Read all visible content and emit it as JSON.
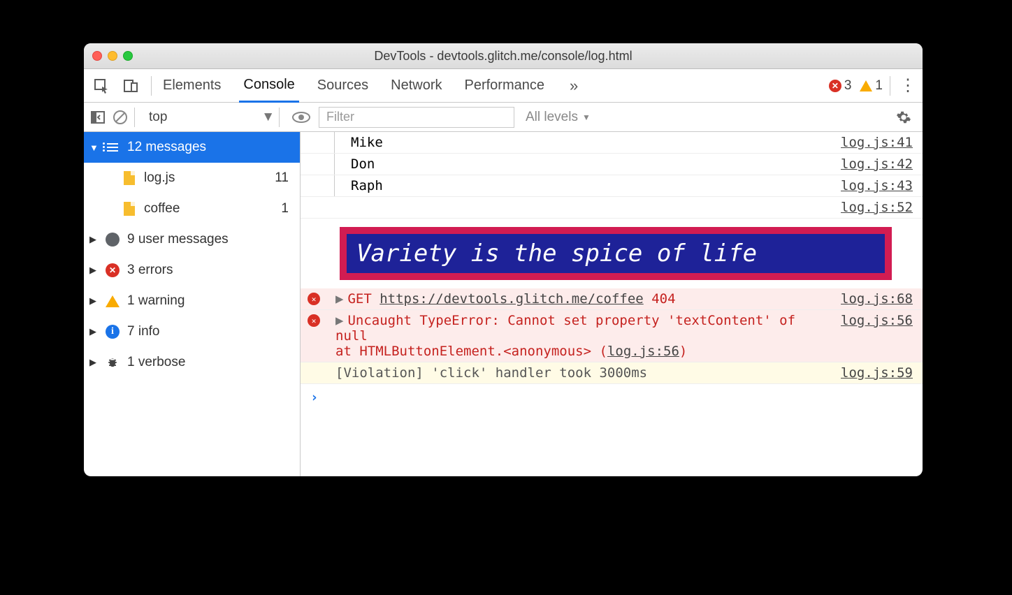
{
  "window": {
    "title": "DevTools - devtools.glitch.me/console/log.html"
  },
  "toolbar": {
    "tabs": [
      "Elements",
      "Console",
      "Sources",
      "Network",
      "Performance"
    ],
    "active_tab": "Console",
    "more": "»",
    "error_count": "3",
    "warning_count": "1"
  },
  "consolebar": {
    "context": "top",
    "filter_placeholder": "Filter",
    "levels_label": "All levels"
  },
  "sidebar": {
    "messages": {
      "label": "12 messages",
      "children": [
        {
          "name": "log.js",
          "count": "11"
        },
        {
          "name": "coffee",
          "count": "1"
        }
      ]
    },
    "groups": [
      {
        "icon": "user",
        "label": "9 user messages"
      },
      {
        "icon": "error",
        "label": "3 errors"
      },
      {
        "icon": "warn",
        "label": "1 warning"
      },
      {
        "icon": "info",
        "label": "7 info"
      },
      {
        "icon": "bug",
        "label": "1 verbose"
      }
    ]
  },
  "log": {
    "rows": [
      {
        "text": "Mike",
        "src": "log.js:41"
      },
      {
        "text": "Don",
        "src": "log.js:42"
      },
      {
        "text": "Raph",
        "src": "log.js:43"
      }
    ],
    "banner_src": "log.js:52",
    "banner_text": "Variety is the spice of life",
    "net_error": {
      "method": "GET",
      "url": "https://devtools.glitch.me/coffee",
      "status": "404",
      "src": "log.js:68"
    },
    "type_error": {
      "msg": "Uncaught TypeError: Cannot set property 'textContent' of null",
      "stack": "    at HTMLButtonElement.<anonymous> (",
      "loc": "log.js:56",
      "src": "log.js:56"
    },
    "violation": {
      "text": "[Violation] 'click' handler took 3000ms",
      "src": "log.js:59"
    },
    "prompt": "›"
  }
}
